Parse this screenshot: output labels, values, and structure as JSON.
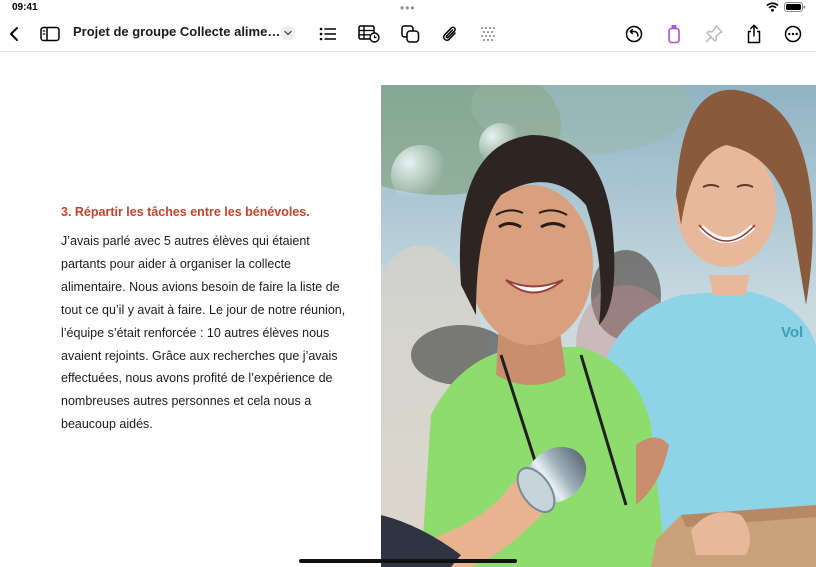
{
  "status": {
    "time": "09:41",
    "icons": [
      "wifi-icon",
      "battery-icon"
    ]
  },
  "toolbar": {
    "document_title": "Projet de groupe Collecte alimentai…",
    "left_icons": [
      "back-chevron-icon",
      "sidebar-icon"
    ],
    "insert_icons": [
      "list-icon",
      "table-chart-icon",
      "shapes-icon",
      "paperclip-icon",
      "texture-grid-icon"
    ],
    "right_icons": [
      "undo-icon",
      "format-brush-icon",
      "pin-icon",
      "share-icon",
      "more-icon"
    ],
    "accent_color": "#a855c9"
  },
  "document": {
    "heading": "3. Répartir les tâches entre les bénévoles.",
    "paragraph_lines": [
      "J’avais parlé avec  5 autres élèves qui étaient",
      "partants pour aider à organiser la collecte",
      "alimentaire. Nous avions besoin de faire la liste de",
      "tout ce qu’il y avait à faire. Le jour de notre réunion,",
      "l’équipe s’était renforcée : 10 autres élèves nous",
      "avaient rejoints. Grâce aux recherches que j’avais",
      "effectuées, nous avons profité de l’expérience de",
      "nombreuses autres personnes et cela nous a",
      "beaucoup aidés."
    ],
    "heading_color": "#c4442c",
    "photo_shirt_text": "Vol"
  }
}
